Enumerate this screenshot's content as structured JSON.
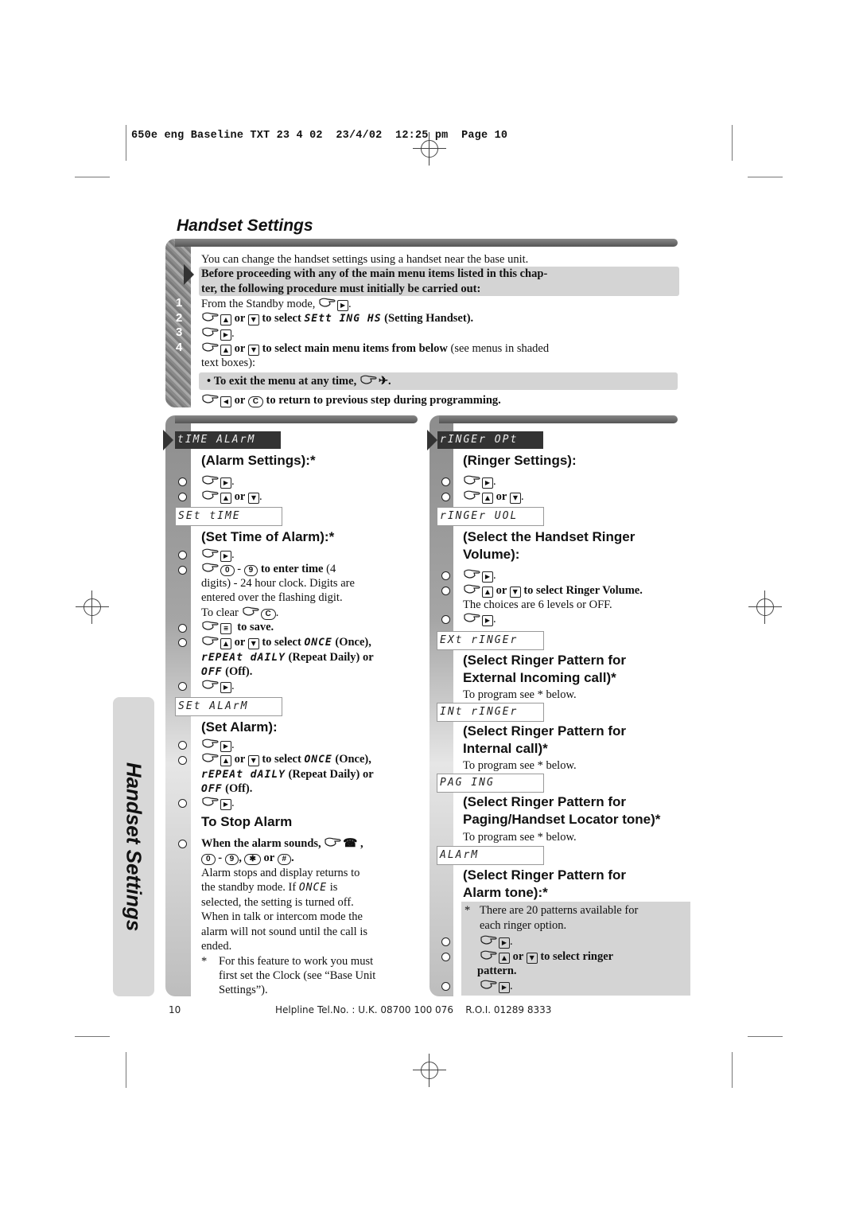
{
  "slug": "650e eng Baseline TXT 23 4 02  23/4/02  12:25 pm  Page 10",
  "title": "Handset Settings",
  "side_tab": "Handset Settings",
  "intro": {
    "line1": "You can change the handset settings using a handset near the base unit.",
    "warning_line1": "Before proceeding with any of the main menu items listed in this chap-",
    "warning_line2": "ter, the following procedure must initially be carried out:",
    "steps": [
      {
        "num": "1",
        "text": "From the Standby mode,",
        "suffix": "."
      },
      {
        "num": "2",
        "pre": "or",
        "mid": "to select",
        "lcd": "SEtt ING HS",
        "post": "(Setting Handset)."
      },
      {
        "num": "3",
        "suffix": "."
      },
      {
        "num": "4",
        "pre": "or",
        "bold_text": "to select main menu items from below",
        "post": "(see menus in shaded",
        "cont": "text boxes):"
      }
    ],
    "exit_note": "To exit the menu at any time,",
    "return_note_or": "or",
    "return_note": "to return to previous step during programming."
  },
  "left_column": {
    "menu_lcd": "tIME ALArM",
    "heading": "(Alarm Settings):*",
    "steps_a": [
      {
        "suffix": "."
      },
      {
        "pre": "or",
        "suffix": "."
      }
    ],
    "set_time_lcd": "SEt tIME",
    "set_time_heading": "(Set Time of Alarm):*",
    "set_time_steps": {
      "enter_dash": "-",
      "enter_bold": "to enter time",
      "enter_rest1": "(4",
      "enter_rest2": "digits) - 24 hour clock. Digits are",
      "enter_rest3": "entered over the flashing digit.",
      "clear": "To clear",
      "save": "to save.",
      "select_pre": "or",
      "select_mid": "to select",
      "once_lcd": "ONCE",
      "once_label": "(Once),",
      "repeat_lcd": "rEPEAt dAILY",
      "repeat_label": "(Repeat Daily) or",
      "off_lcd": "OFF",
      "off_label": "(Off)."
    },
    "set_alarm_lcd": "SEt ALArM",
    "set_alarm_heading": "(Set Alarm):",
    "stop_heading": "To Stop Alarm",
    "stop_when": "When the alarm sounds,",
    "stop_keys_dash": "-",
    "stop_keys_or": "or",
    "stop_text": [
      "Alarm stops and display returns to",
      "the standby mode. If",
      "is",
      "selected, the setting is turned off.",
      "When in talk or intercom mode the",
      "alarm will not sound until the call is",
      "ended."
    ],
    "footnote_star": "*",
    "footnote": [
      "For this feature to work you must",
      "first set the Clock (see “Base Unit",
      "Settings”)."
    ]
  },
  "right_column": {
    "menu_lcd": "rINGEr OPt",
    "heading": "(Ringer Settings):",
    "ringer_vol_lcd": "rINGEr UOL",
    "vol_heading": [
      "(Select the Handset Ringer",
      "Volume):"
    ],
    "vol_select": "to select Ringer Volume.",
    "vol_choices": "The choices are 6 levels or OFF.",
    "ext_lcd": "EXt rINGEr",
    "ext_heading": [
      "(Select Ringer Pattern for",
      "External Incoming call)*"
    ],
    "program_note": "To program see * below.",
    "int_lcd": "INt rINGEr",
    "int_heading": [
      "(Select Ringer Pattern for",
      "Internal call)*"
    ],
    "paging_lcd": "PAG ING",
    "paging_heading": [
      "(Select Ringer Pattern for",
      "Paging/Handset Locator tone)*"
    ],
    "alarm_lcd": "ALArM",
    "alarm_heading": [
      "(Select Ringer Pattern for",
      "Alarm tone):*"
    ],
    "patterns_note": [
      "There are 20 patterns available for",
      "each ringer option."
    ],
    "pattern_select": "to select ringer",
    "pattern_select2": "pattern."
  },
  "keys": {
    "zero": "0",
    "nine": "9",
    "c": "C",
    "star": "✱",
    "hash": "#",
    "or": "or"
  },
  "footer": {
    "page_number": "10",
    "helpline": "Helpline Tel.No. : U.K. 08700 100 076    R.O.I. 01289 8333"
  }
}
